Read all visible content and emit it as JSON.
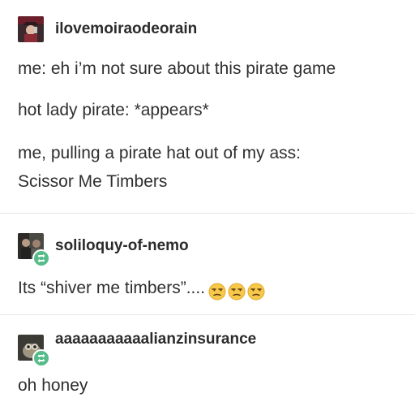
{
  "posts": [
    {
      "username": "ilovemoiraodeorain",
      "lines": [
        "me: eh i’m not sure about this pirate game",
        "hot lady pirate: *appears*",
        "me, pulling a pirate hat out of my ass:",
        "Scissor Me Timbers"
      ]
    },
    {
      "username": "soliloquy-of-nemo",
      "body": "Its “shiver me timbers”....",
      "emoji": [
        "unamused-face-icon",
        "unamused-face-icon",
        "unamused-face-icon"
      ]
    },
    {
      "username": "aaaaaaaaaaalianzinsurance",
      "body": "oh honey"
    }
  ],
  "colors": {
    "reblog_badge": "#56bc8a",
    "divider": "#e6e6e6",
    "text": "#2b2b2b"
  }
}
